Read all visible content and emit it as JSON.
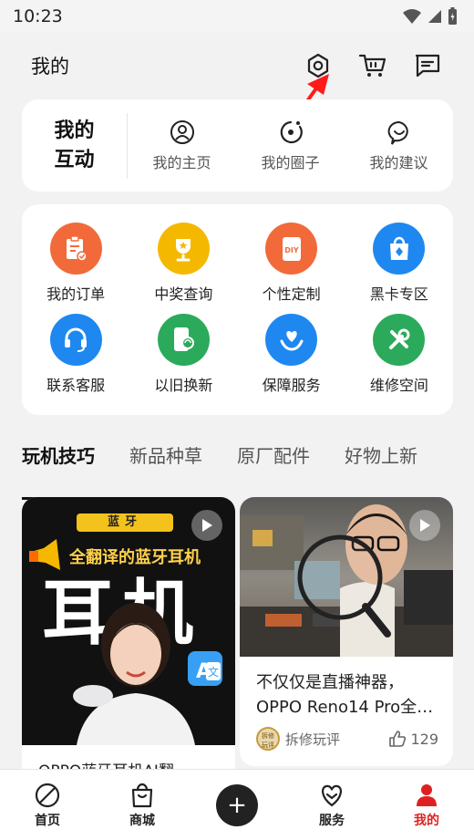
{
  "status": {
    "time": "10:23"
  },
  "header": {
    "title": "我的"
  },
  "interaction": {
    "title_line1": "我的",
    "title_line2": "互动",
    "items": [
      {
        "label": "我的主页",
        "icon": "user-icon"
      },
      {
        "label": "我的圈子",
        "icon": "circle-icon"
      },
      {
        "label": "我的建议",
        "icon": "suggestion-icon"
      }
    ]
  },
  "services": [
    {
      "label": "我的订单",
      "icon": "order-icon",
      "color": "#f26a3a"
    },
    {
      "label": "中奖查询",
      "icon": "trophy-icon",
      "color": "#f5b800"
    },
    {
      "label": "个性定制",
      "icon": "diy-icon",
      "color": "#f26a3a"
    },
    {
      "label": "黑卡专区",
      "icon": "bag-icon",
      "color": "#1e88f0"
    },
    {
      "label": "联系客服",
      "icon": "headset-icon",
      "color": "#1e88f0"
    },
    {
      "label": "以旧换新",
      "icon": "phone-swap-icon",
      "color": "#2aaa5a"
    },
    {
      "label": "保障服务",
      "icon": "heart-hand-icon",
      "color": "#1e88f0"
    },
    {
      "label": "维修空间",
      "icon": "tools-icon",
      "color": "#2aaa5a"
    }
  ],
  "tabs": [
    "玩机技巧",
    "新品种草",
    "原厂配件",
    "好物上新"
  ],
  "feed": {
    "left": {
      "badge": "蓝牙",
      "headline": "全翻译的蓝牙耳机",
      "big_text": "耳机",
      "caption": "OPPO蓝牙耳机AI翻"
    },
    "right": {
      "caption_line1": "不仅仅是直播神器，",
      "caption_line2": "OPPO Reno14 Pro全…",
      "author_badge": "拆修 玩评",
      "author": "拆修玩评",
      "likes": "129"
    }
  },
  "nav": [
    {
      "label": "首页",
      "icon": "home-icon"
    },
    {
      "label": "商城",
      "icon": "shop-bag-icon"
    },
    {
      "label": "+",
      "icon": "plus-icon"
    },
    {
      "label": "服务",
      "icon": "service-heart-icon"
    },
    {
      "label": "我的",
      "icon": "me-icon"
    }
  ],
  "accent": "#e02020"
}
